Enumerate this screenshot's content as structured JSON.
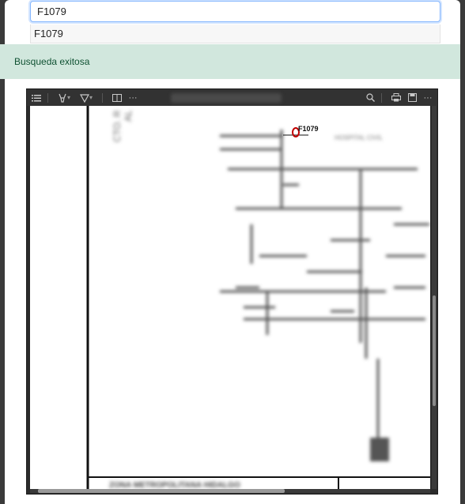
{
  "search": {
    "value": "F1079"
  },
  "suggestions": [
    "F1079"
  ],
  "alert": {
    "message": "Busqueda exitosa"
  },
  "viewer": {
    "marker_label": "F1079",
    "blurred_texts": [
      "CTO. R",
      "AL",
      "HOSPITAL CIVIL",
      "ZONA METROPOLITANA HIDALGO"
    ]
  },
  "colors": {
    "alert_bg": "#d1e7dd",
    "alert_text": "#0f5132",
    "focus_border": "#86b7fe",
    "marker": "#c00000"
  }
}
